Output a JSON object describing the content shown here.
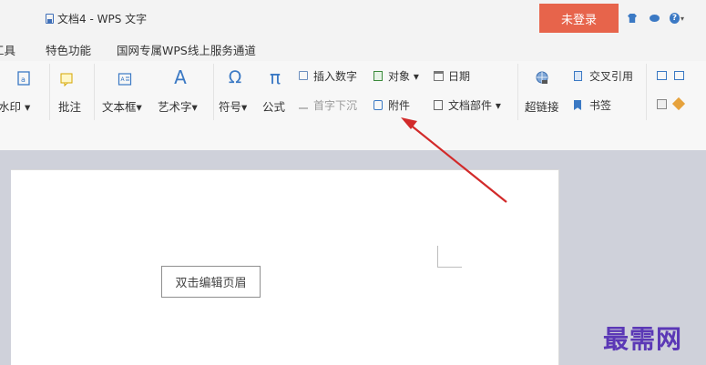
{
  "title_bar": {
    "doc_title": "文档4 - WPS 文字",
    "login_button": "未登录"
  },
  "menu": {
    "items": [
      "工具",
      "特色功能",
      "国网专属WPS线上服务通道"
    ]
  },
  "ribbon": {
    "watermark": "水印",
    "comment": "批注",
    "textbox": "文本框",
    "arttext": "艺术字",
    "symbol": "符号",
    "formula": "公式",
    "insert_number": "插入数字",
    "object": "对象",
    "date": "日期",
    "dropcap": "首字下沉",
    "attachment": "附件",
    "doc_parts": "文档部件",
    "cross_ref": "交叉引用",
    "hyperlink": "超链接",
    "bookmark": "书签"
  },
  "document": {
    "header_tooltip": "双击编辑页眉"
  },
  "watermark_text": "最需网",
  "colors": {
    "login_bg": "#e7644b",
    "canvas_bg": "#cfd1da",
    "arrow": "#d22a2a",
    "watermark": "#5b38b6"
  }
}
